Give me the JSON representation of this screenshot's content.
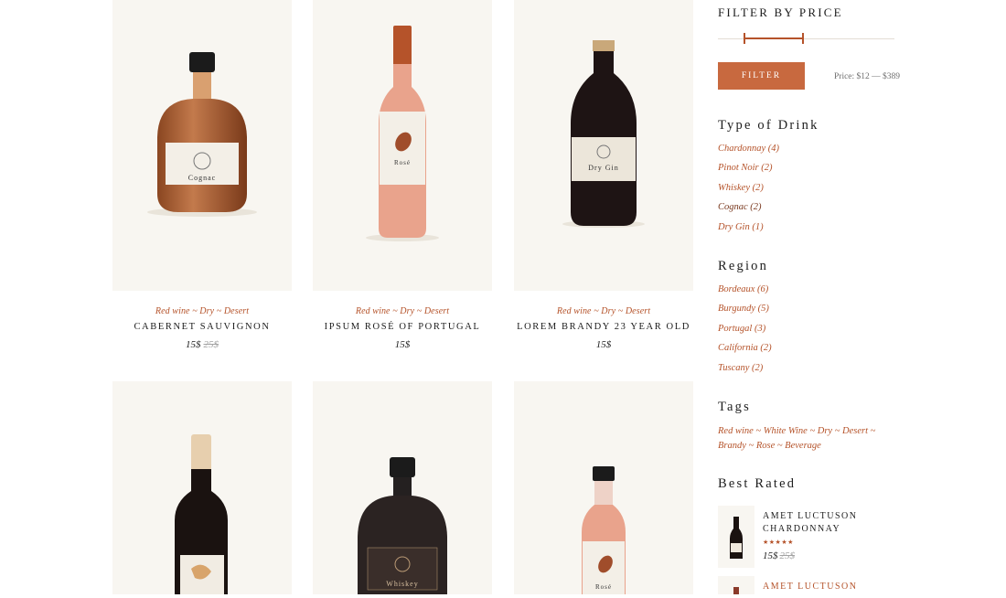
{
  "products": [
    {
      "categories": "Red wine ~ Dry ~ Desert",
      "name": "Cabernet Sauvignon",
      "price": "15$",
      "old_price": "25$",
      "label": "Cognac"
    },
    {
      "categories": "Red wine ~ Dry ~ Desert",
      "name": "Ipsum Rosé of Portugal",
      "price": "15$",
      "old_price": "",
      "label": "Rosé"
    },
    {
      "categories": "Red wine ~ Dry ~ Desert",
      "name": "Lorem Brandy 23 Year Old",
      "price": "15$",
      "old_price": "",
      "label": "Dry Gin"
    },
    {
      "label": ""
    },
    {
      "label": "Whiskey"
    },
    {
      "label": "Rosé"
    }
  ],
  "sidebar": {
    "price_filter": {
      "title": "Filter by price",
      "button": "Filter",
      "range_text": "Price: $12 — $389",
      "range_min_fraction": 0.15,
      "range_max_fraction": 0.48
    },
    "type_of_drink": {
      "title": "Type of Drink",
      "items": [
        "Chardonnay (4)",
        "Pinot Noir (2)",
        "Whiskey (2)",
        "Cognac (2)",
        "Dry Gin (1)"
      ]
    },
    "region": {
      "title": "Region",
      "items": [
        "Bordeaux (6)",
        "Burgundy (5)",
        "Portugal (3)",
        "California (2)",
        "Tuscany (2)"
      ]
    },
    "tags": {
      "title": "Tags",
      "text": "Red wine ~ White Wine ~ Dry ~ Desert ~ Brandy ~ Rose ~ Beverage"
    },
    "best_rated": {
      "title": "Best Rated",
      "items": [
        {
          "name": "Amet Luctuson Chardonnay",
          "rating": 5,
          "stars": "★★★★★",
          "price": "15$",
          "old_price": "25$"
        },
        {
          "name": "Amet Luctuson"
        }
      ]
    }
  },
  "colors": {
    "accent": "#b5532a",
    "button": "#c8693f",
    "card_bg": "#f8f6f1"
  }
}
